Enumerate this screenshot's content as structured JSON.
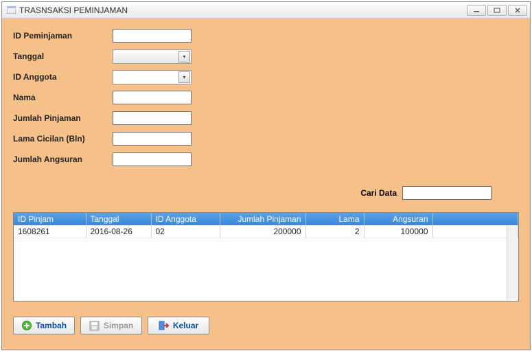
{
  "window": {
    "title": "TRASNSAKSI PEMINJAMAN"
  },
  "form": {
    "id_peminjaman": {
      "label": "ID Peminjaman",
      "value": ""
    },
    "tanggal": {
      "label": "Tanggal",
      "value": ""
    },
    "id_anggota": {
      "label": "ID Anggota",
      "value": ""
    },
    "nama": {
      "label": "Nama",
      "value": ""
    },
    "jumlah_pinjaman": {
      "label": "Jumlah Pinjaman",
      "value": ""
    },
    "lama_cicilan": {
      "label": "Lama Cicilan (Bln)",
      "value": ""
    },
    "jumlah_angsuran": {
      "label": "Jumlah Angsuran",
      "value": ""
    }
  },
  "search": {
    "label": "Cari Data",
    "value": ""
  },
  "grid": {
    "headers": {
      "id_pinjam": "ID Pinjam",
      "tanggal": "Tanggal",
      "id_anggota": "ID Anggota",
      "jumlah_pinjaman": "Jumlah Pinjaman",
      "lama": "Lama",
      "angsuran": "Angsuran"
    },
    "rows": [
      {
        "id_pinjam": "1608261",
        "tanggal": "2016-08-26",
        "id_anggota": "02",
        "jumlah_pinjaman": "200000",
        "lama": "2",
        "angsuran": "100000"
      }
    ]
  },
  "buttons": {
    "tambah": "Tambah",
    "simpan": "Simpan",
    "keluar": "Keluar"
  }
}
